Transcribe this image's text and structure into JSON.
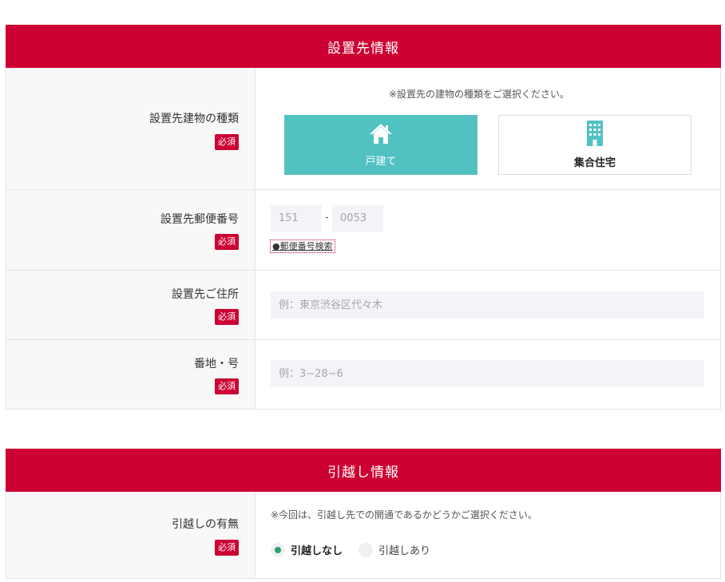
{
  "required_badge": "必須",
  "colors": {
    "brand_red": "#cc0033",
    "selected_teal": "#52c1c1",
    "radio_green": "#2e9e6b"
  },
  "installation": {
    "title": "設置先情報",
    "building_type": {
      "label": "設置先建物の種類",
      "note": "※設置先の建物の種類をご選択ください。",
      "options": [
        {
          "label": "戸建て",
          "icon": "house-icon",
          "selected": true
        },
        {
          "label": "集合住宅",
          "icon": "apartment-building-icon",
          "selected": false
        }
      ]
    },
    "postal": {
      "label": "設置先郵便番号",
      "first_placeholder": "151",
      "separator": "-",
      "second_placeholder": "0053",
      "search_link": "●郵便番号検索"
    },
    "address": {
      "label": "設置先ご住所",
      "placeholder": "例：東京渋谷区代々木"
    },
    "street": {
      "label": "番地・号",
      "placeholder": "例：3−28−6"
    }
  },
  "moving": {
    "title": "引越し情報",
    "has_moving": {
      "label": "引越しの有無",
      "note": "※今回は、引越し先での開通であるかどうかご選択ください。",
      "options": [
        {
          "label": "引越しなし",
          "selected": true
        },
        {
          "label": "引越しあり",
          "selected": false
        }
      ]
    }
  }
}
